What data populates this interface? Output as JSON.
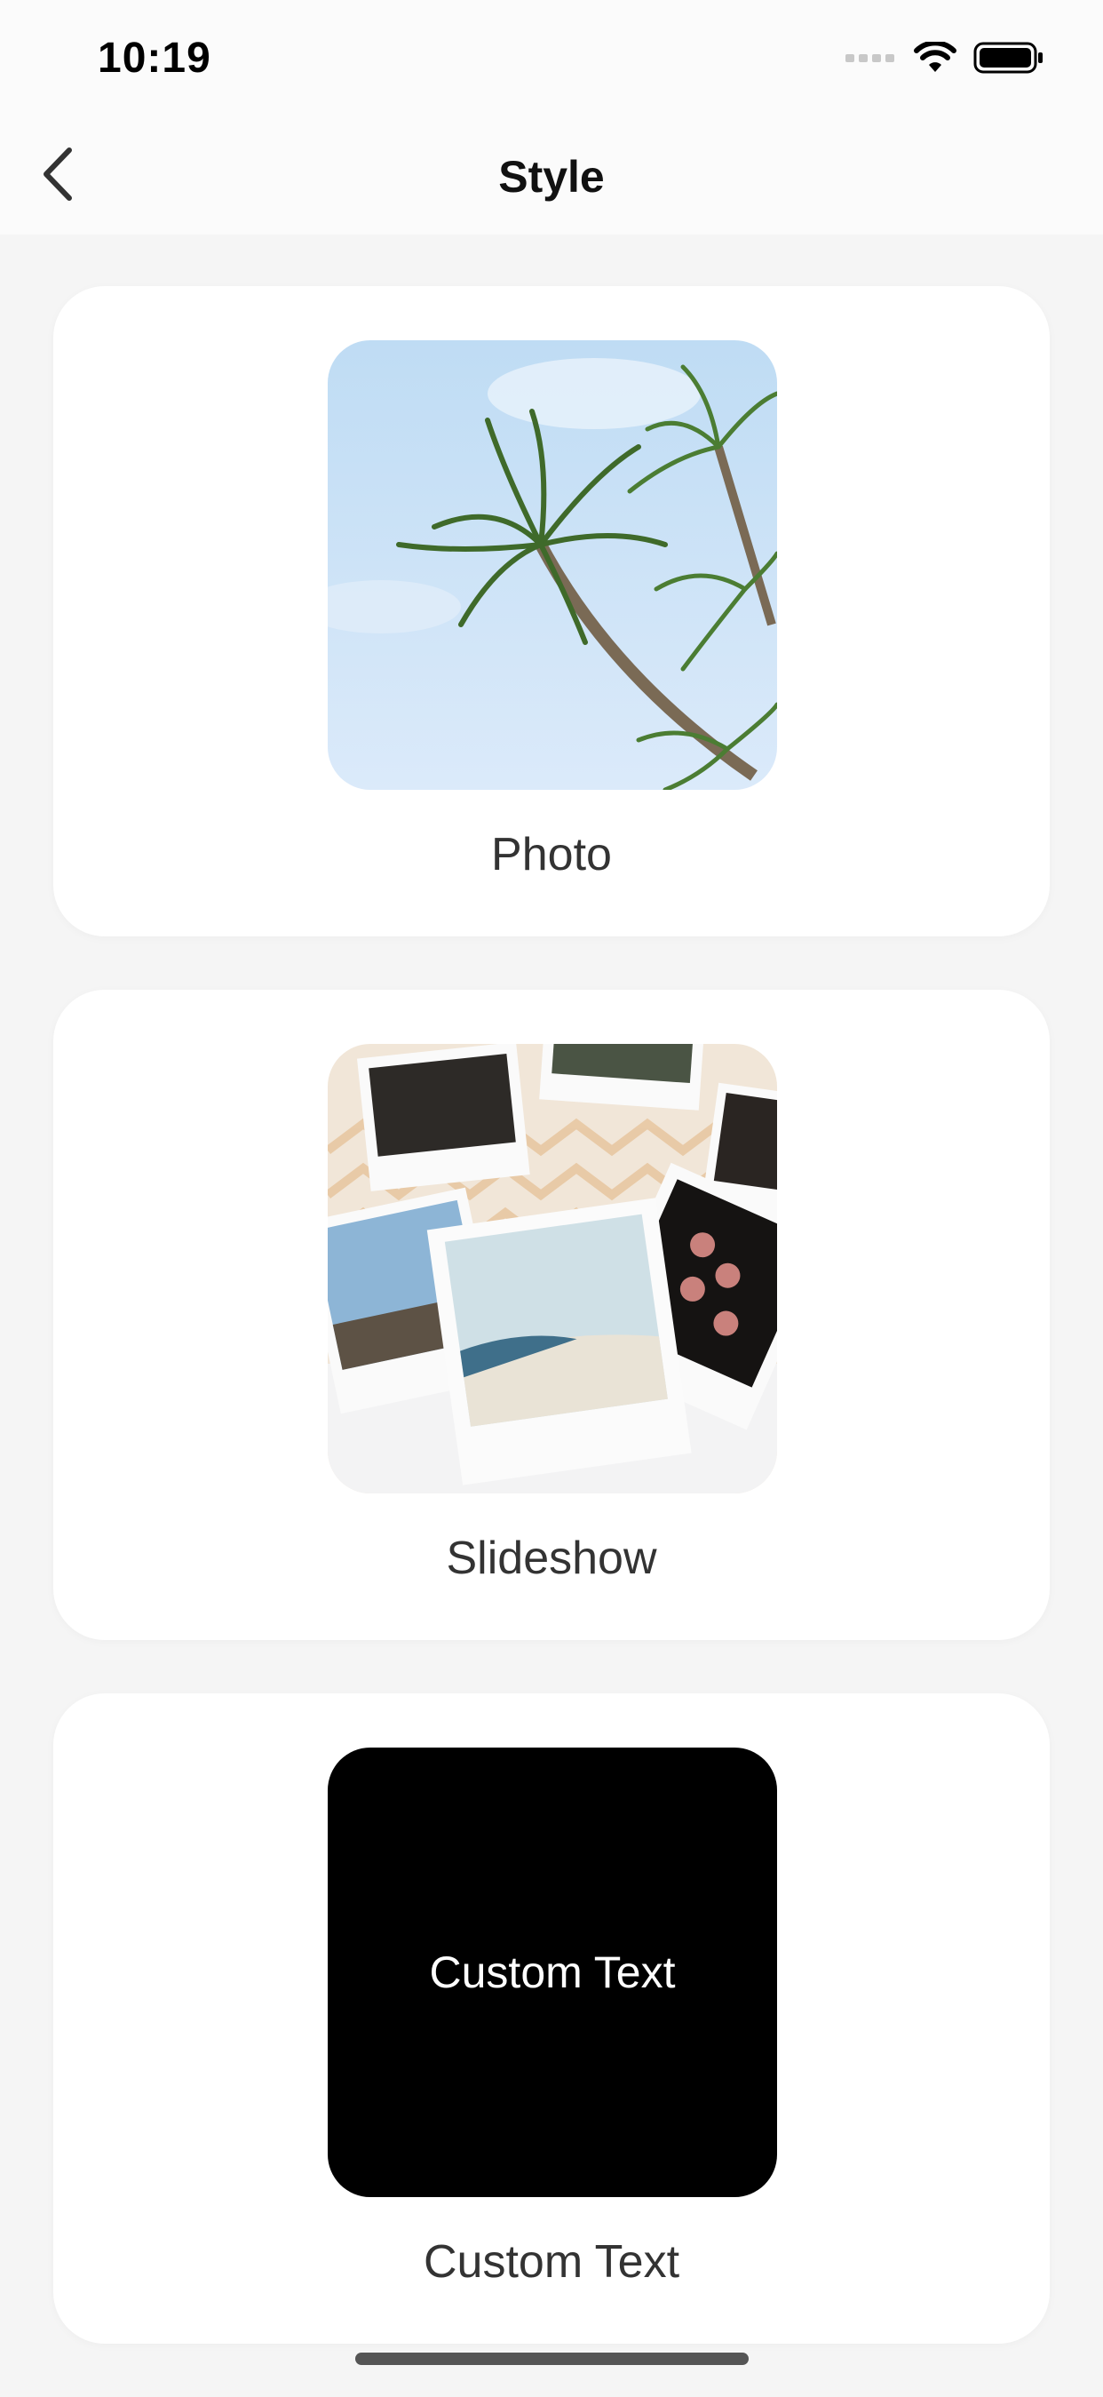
{
  "status_bar": {
    "time": "10:19"
  },
  "header": {
    "title": "Style"
  },
  "styles": [
    {
      "label": "Photo"
    },
    {
      "label": "Slideshow"
    },
    {
      "label": "Custom Text",
      "preview_text": "Custom Text"
    }
  ],
  "colors": {
    "background": "#f5f5f5",
    "card": "#ffffff",
    "custom_text_bg": "#000000"
  }
}
